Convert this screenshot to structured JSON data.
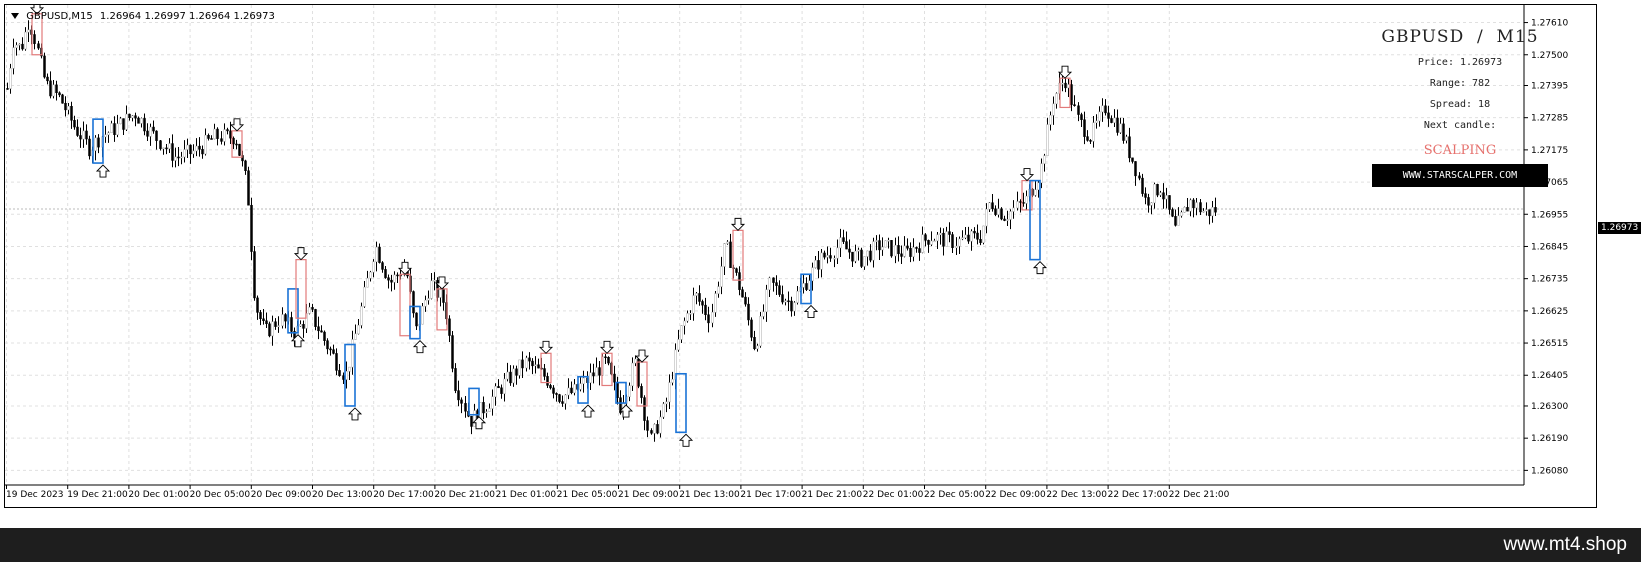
{
  "header": {
    "symbol_tf": "GBPUSD,M15",
    "ohlc": "1.26964 1.26997 1.26964 1.26973"
  },
  "info_panel": {
    "title": "GBPUSD  /  M15",
    "price": "Price: 1.26973",
    "range": "Range: 782",
    "spread": "Spread: 18",
    "next_candle": "Next candle:",
    "mode": "SCALPING",
    "link": "WWW.STARSCALPER.COM"
  },
  "current_price_tag": "1.26973",
  "brand": "www.mt4.shop",
  "colors": {
    "bear_box": "#e27a7a",
    "bull_box": "#1a73d6",
    "candle_bull": "#ffffff",
    "candle_bear": "#000000",
    "grid": "#e0e0e0"
  },
  "chart_data": {
    "type": "candlestick",
    "symbol": "GBPUSD",
    "timeframe": "M15",
    "ylim": [
      1.2603,
      1.2767
    ],
    "y_ticks": [
      "1.27610",
      "1.27500",
      "1.27395",
      "1.27285",
      "1.27175",
      "1.27065",
      "1.26955",
      "1.26845",
      "1.26735",
      "1.26625",
      "1.26515",
      "1.26405",
      "1.26300",
      "1.26190",
      "1.26080"
    ],
    "x_ticks": [
      "19 Dec 2023",
      "19 Dec 21:00",
      "20 Dec 01:00",
      "20 Dec 05:00",
      "20 Dec 09:00",
      "20 Dec 13:00",
      "20 Dec 17:00",
      "20 Dec 21:00",
      "21 Dec 01:00",
      "21 Dec 05:00",
      "21 Dec 09:00",
      "21 Dec 13:00",
      "21 Dec 17:00",
      "21 Dec 21:00",
      "22 Dec 01:00",
      "22 Dec 05:00",
      "22 Dec 09:00",
      "22 Dec 13:00",
      "22 Dec 17:00",
      "22 Dec 21:00"
    ],
    "grid": true,
    "price_path": [
      [
        0,
        1.2733
      ],
      [
        8,
        1.2755
      ],
      [
        16,
        1.2752
      ],
      [
        24,
        1.2762
      ],
      [
        30,
        1.2755
      ],
      [
        40,
        1.274
      ],
      [
        55,
        1.2735
      ],
      [
        70,
        1.2725
      ],
      [
        85,
        1.2718
      ],
      [
        95,
        1.2722
      ],
      [
        110,
        1.2725
      ],
      [
        130,
        1.273
      ],
      [
        150,
        1.2722
      ],
      [
        170,
        1.2715
      ],
      [
        190,
        1.2717
      ],
      [
        210,
        1.2722
      ],
      [
        230,
        1.2722
      ],
      [
        242,
        1.2705
      ],
      [
        250,
        1.2665
      ],
      [
        260,
        1.2655
      ],
      [
        275,
        1.266
      ],
      [
        290,
        1.2655
      ],
      [
        305,
        1.2662
      ],
      [
        320,
        1.2652
      ],
      [
        340,
        1.264
      ],
      [
        355,
        1.2662
      ],
      [
        370,
        1.2685
      ],
      [
        385,
        1.2672
      ],
      [
        400,
        1.2678
      ],
      [
        410,
        1.2655
      ],
      [
        425,
        1.2672
      ],
      [
        440,
        1.2665
      ],
      [
        450,
        1.2638
      ],
      [
        465,
        1.2625
      ],
      [
        480,
        1.263
      ],
      [
        500,
        1.2638
      ],
      [
        520,
        1.2645
      ],
      [
        540,
        1.264
      ],
      [
        555,
        1.2633
      ],
      [
        570,
        1.2635
      ],
      [
        585,
        1.264
      ],
      [
        600,
        1.2645
      ],
      [
        615,
        1.263
      ],
      [
        630,
        1.2645
      ],
      [
        645,
        1.2618
      ],
      [
        660,
        1.263
      ],
      [
        675,
        1.2655
      ],
      [
        690,
        1.2668
      ],
      [
        705,
        1.266
      ],
      [
        720,
        1.2685
      ],
      [
        735,
        1.267
      ],
      [
        750,
        1.265
      ],
      [
        765,
        1.2672
      ],
      [
        785,
        1.2665
      ],
      [
        800,
        1.2672
      ],
      [
        815,
        1.268
      ],
      [
        835,
        1.2685
      ],
      [
        855,
        1.268
      ],
      [
        875,
        1.2685
      ],
      [
        900,
        1.2682
      ],
      [
        925,
        1.2688
      ],
      [
        950,
        1.2686
      ],
      [
        975,
        1.2688
      ],
      [
        985,
        1.27
      ],
      [
        1000,
        1.2695
      ],
      [
        1020,
        1.27
      ],
      [
        1035,
        1.271
      ],
      [
        1048,
        1.2735
      ],
      [
        1060,
        1.2742
      ],
      [
        1072,
        1.2728
      ],
      [
        1085,
        1.2722
      ],
      [
        1100,
        1.2732
      ],
      [
        1115,
        1.2725
      ],
      [
        1130,
        1.2712
      ],
      [
        1140,
        1.27
      ],
      [
        1155,
        1.2705
      ],
      [
        1170,
        1.269
      ],
      [
        1185,
        1.27
      ],
      [
        1200,
        1.2696
      ],
      [
        1212,
        1.26973
      ]
    ],
    "signals": [
      {
        "type": "sell",
        "x": 32,
        "hi": 1.2764,
        "lo": 1.275
      },
      {
        "type": "buy",
        "x": 93,
        "hi": 1.2728,
        "lo": 1.2713
      },
      {
        "type": "sell",
        "x": 232,
        "hi": 1.2724,
        "lo": 1.2715
      },
      {
        "type": "buy",
        "x": 288,
        "hi": 1.267,
        "lo": 1.2655
      },
      {
        "type": "sell",
        "x": 296,
        "hi": 1.268,
        "lo": 1.266
      },
      {
        "type": "buy",
        "x": 345,
        "hi": 1.2651,
        "lo": 1.263
      },
      {
        "type": "sell",
        "x": 400,
        "hi": 1.2675,
        "lo": 1.2654
      },
      {
        "type": "buy",
        "x": 410,
        "hi": 1.2664,
        "lo": 1.2653
      },
      {
        "type": "sell",
        "x": 437,
        "hi": 1.267,
        "lo": 1.2656
      },
      {
        "type": "buy",
        "x": 469,
        "hi": 1.2636,
        "lo": 1.2627
      },
      {
        "type": "sell",
        "x": 541,
        "hi": 1.2648,
        "lo": 1.2638
      },
      {
        "type": "buy",
        "x": 578,
        "hi": 1.264,
        "lo": 1.2631
      },
      {
        "type": "sell",
        "x": 602,
        "hi": 1.2648,
        "lo": 1.2637
      },
      {
        "type": "buy",
        "x": 616,
        "hi": 1.2638,
        "lo": 1.2631
      },
      {
        "type": "sell",
        "x": 637,
        "hi": 1.2645,
        "lo": 1.263
      },
      {
        "type": "buy",
        "x": 676,
        "hi": 1.2641,
        "lo": 1.2621
      },
      {
        "type": "sell",
        "x": 733,
        "hi": 1.269,
        "lo": 1.2673
      },
      {
        "type": "buy",
        "x": 801,
        "hi": 1.2675,
        "lo": 1.2665
      },
      {
        "type": "sell",
        "x": 1022,
        "hi": 1.2707,
        "lo": 1.2697
      },
      {
        "type": "buy",
        "x": 1030,
        "hi": 1.2707,
        "lo": 1.268
      },
      {
        "type": "sell",
        "x": 1060,
        "hi": 1.2742,
        "lo": 1.2732
      }
    ]
  }
}
